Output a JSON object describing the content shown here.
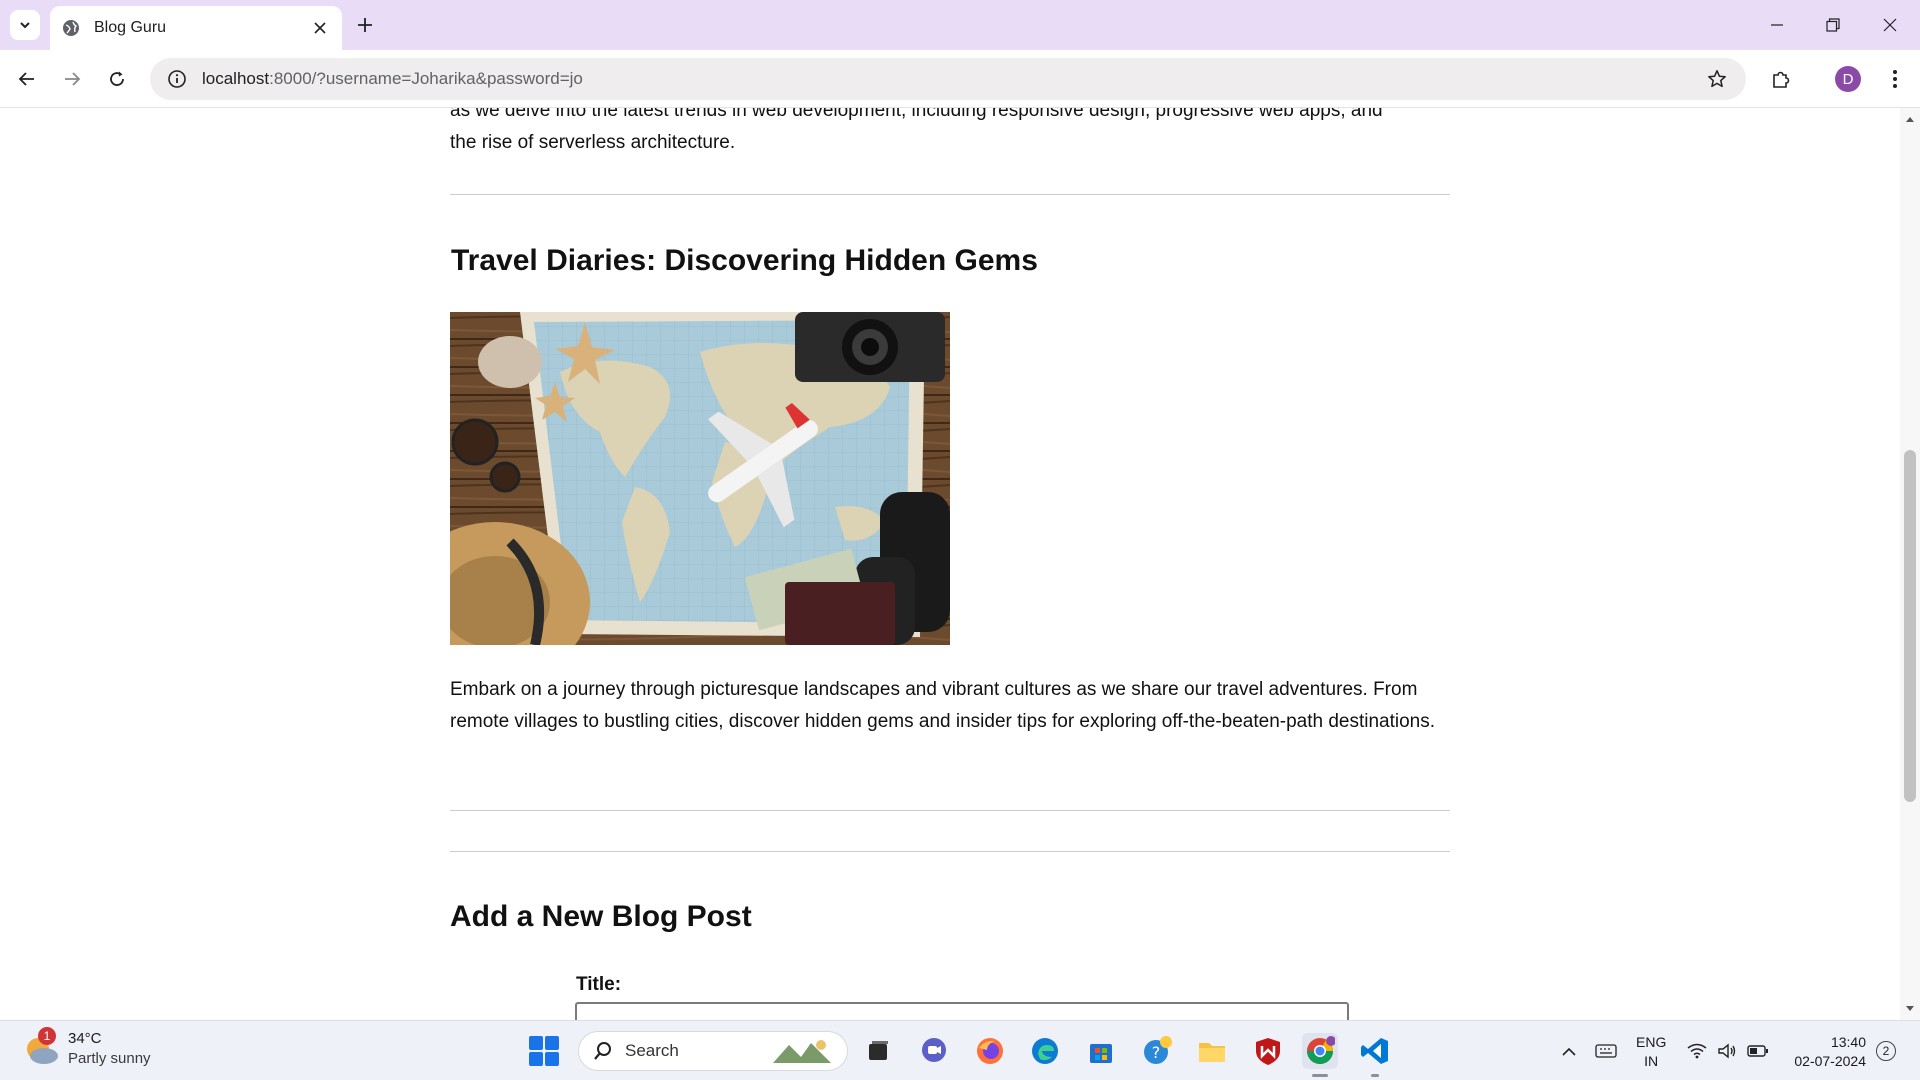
{
  "browser": {
    "tab_title": "Blog Guru",
    "url_host": "localhost",
    "url_rest": ":8000/?username=Joharika&password=jo",
    "profile_initial": "D"
  },
  "page": {
    "intro_text_cut": "as we delve into the latest trends in web development, including responsive design, progressive web apps, and",
    "intro_text_end": "the rise of serverless architecture.",
    "post": {
      "title": "Travel Diaries: Discovering Hidden Gems",
      "body": "Embark on a journey through picturesque landscapes and vibrant cultures as we share our travel adventures. From remote villages to bustling cities, discover hidden gems and insider tips for exploring off-the-beaten-path destinations."
    },
    "form": {
      "section_title": "Add a New Blog Post",
      "title_label": "Title:"
    }
  },
  "taskbar": {
    "weather_badge": "1",
    "weather_temp": "34°C",
    "weather_condition": "Partly sunny",
    "search_label": "Search",
    "language_top": "ENG",
    "language_bottom": "IN",
    "time": "13:40",
    "date": "02-07-2024",
    "notification_count": "2",
    "vscode_color": "#0078d4",
    "accent": "#0067c0"
  }
}
